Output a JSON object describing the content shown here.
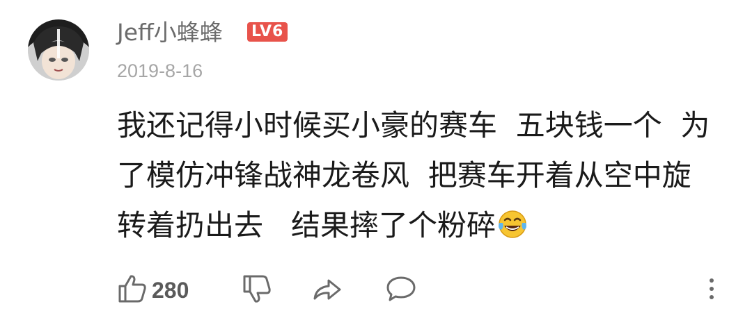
{
  "comment": {
    "username": "Jeff小蜂蜂",
    "level": "LV6",
    "date": "2019-8-16",
    "lines": [
      "我还记得小时候买小豪的赛车  五块钱一个  为",
      "了模仿冲锋战神龙卷风  把赛车开着从空中旋",
      "转着扔出去   结果摔了个粉碎"
    ],
    "emoji": "laughing-tears-icon",
    "like_count": "280"
  },
  "colors": {
    "badge": "#e8534b",
    "username": "#6b6b6b",
    "date": "#a6a6a6",
    "text": "#1a1a1a",
    "icon": "#6a6a6a"
  },
  "icons": [
    "thumbs-up-icon",
    "thumbs-down-icon",
    "share-icon",
    "comment-icon",
    "more-vertical-icon"
  ]
}
